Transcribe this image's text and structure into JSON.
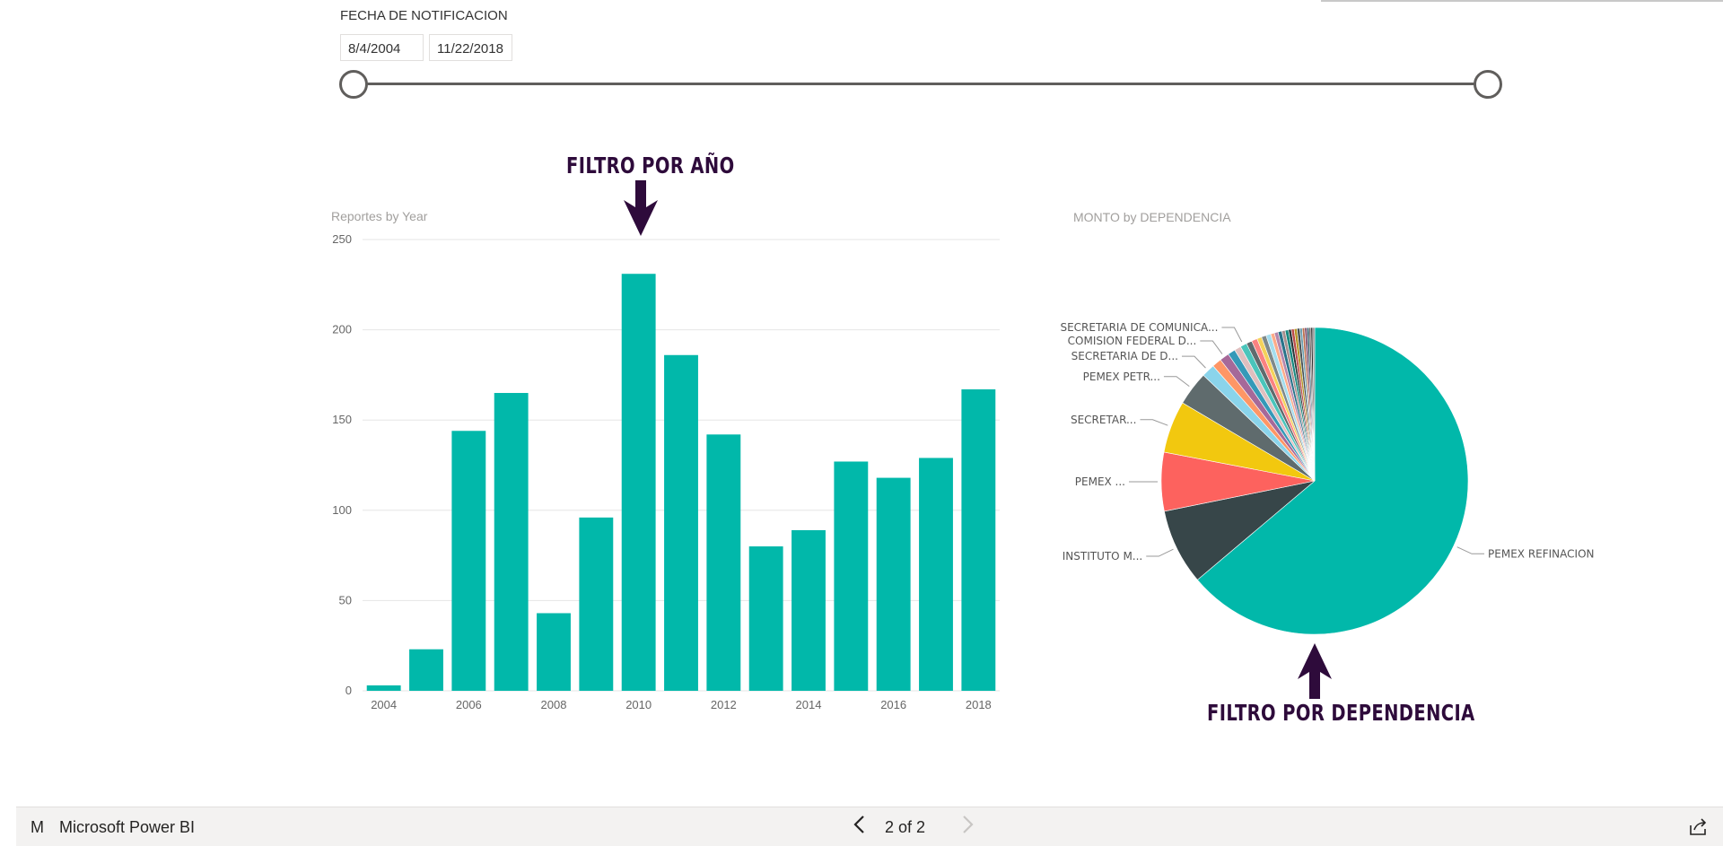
{
  "slicer": {
    "title": "FECHA DE NOTIFICACION",
    "start_date": "8/4/2004",
    "end_date": "11/22/2018"
  },
  "annotations": {
    "year_filter": "FILTRO POR AÑO",
    "dependency_filter": "FILTRO POR DEPENDENCIA",
    "color": "#2e0b3b"
  },
  "chart_data": [
    {
      "type": "bar",
      "title": "Reportes by Year",
      "categories": [
        "2004",
        "2005",
        "2006",
        "2007",
        "2008",
        "2009",
        "2010",
        "2011",
        "2012",
        "2013",
        "2014",
        "2015",
        "2016",
        "2017",
        "2018"
      ],
      "x_tick_labels": [
        "2004",
        "2006",
        "2008",
        "2010",
        "2012",
        "2014",
        "2016",
        "2018"
      ],
      "values": [
        3,
        23,
        144,
        165,
        43,
        96,
        231,
        186,
        142,
        80,
        89,
        127,
        118,
        129,
        167
      ],
      "ylim": [
        0,
        250
      ],
      "y_ticks": [
        0,
        50,
        100,
        150,
        200,
        250
      ],
      "grid": true,
      "color": "#01b8aa"
    },
    {
      "type": "pie",
      "title": "MONTO by DEPENDENCIA",
      "slices": [
        {
          "label": "PEMEX REFINACION",
          "value": 64.0,
          "color": "#01b8aa"
        },
        {
          "label": "INSTITUTO M...",
          "value": 8.0,
          "color": "#374649"
        },
        {
          "label": "PEMEX ...",
          "value": 6.2,
          "color": "#fd625e"
        },
        {
          "label": "SECRETAR...",
          "value": 5.5,
          "color": "#f2c80f"
        },
        {
          "label": "PEMEX PETR...",
          "value": 3.6,
          "color": "#5f6b6d"
        },
        {
          "label": "SECRETARIA DE D...",
          "value": 1.4,
          "color": "#8ad4eb"
        },
        {
          "label": "",
          "value": 1.0,
          "color": "#fe9666"
        },
        {
          "label": "COMISION FEDERAL D...",
          "value": 1.0,
          "color": "#a66999"
        },
        {
          "label": "",
          "value": 0.8,
          "color": "#3599b8"
        },
        {
          "label": "",
          "value": 0.7,
          "color": "#dfbfbf"
        },
        {
          "label": "SECRETARIA DE COMUNICA...",
          "value": 0.7,
          "color": "#4ac5bb"
        },
        {
          "label": "",
          "value": 0.6,
          "color": "#5f6b6d"
        },
        {
          "label": "",
          "value": 0.6,
          "color": "#fb8281"
        },
        {
          "label": "",
          "value": 0.5,
          "color": "#f4d25a"
        },
        {
          "label": "",
          "value": 0.5,
          "color": "#7f898a"
        },
        {
          "label": "",
          "value": 0.5,
          "color": "#a4ddee"
        },
        {
          "label": "",
          "value": 0.4,
          "color": "#fdab89"
        },
        {
          "label": "",
          "value": 0.4,
          "color": "#b687ac"
        },
        {
          "label": "",
          "value": 0.4,
          "color": "#28738a"
        },
        {
          "label": "",
          "value": 0.35,
          "color": "#a78f8f"
        },
        {
          "label": "",
          "value": 0.35,
          "color": "#168980"
        },
        {
          "label": "",
          "value": 0.3,
          "color": "#293537"
        },
        {
          "label": "",
          "value": 0.3,
          "color": "#bb4a4a"
        },
        {
          "label": "",
          "value": 0.3,
          "color": "#b59525"
        },
        {
          "label": "",
          "value": 0.3,
          "color": "#475052"
        },
        {
          "label": "",
          "value": 0.25,
          "color": "#6a9fb0"
        },
        {
          "label": "",
          "value": 0.25,
          "color": "#bd7150"
        },
        {
          "label": "",
          "value": 0.25,
          "color": "#7b4f71"
        },
        {
          "label": "",
          "value": 0.2,
          "color": "#1b4d5c"
        },
        {
          "label": "",
          "value": 0.2,
          "color": "#706060"
        },
        {
          "label": "",
          "value": 0.2,
          "color": "#333333"
        },
        {
          "label": "",
          "value": 0.2,
          "color": "#888888"
        }
      ]
    }
  ],
  "footer": {
    "logo_letter": "M",
    "brand": "Microsoft Power BI",
    "page_indicator": "2 of 2",
    "prev_icon": "chevron-left-icon",
    "next_icon": "chevron-right-icon",
    "share_icon": "share-icon"
  }
}
